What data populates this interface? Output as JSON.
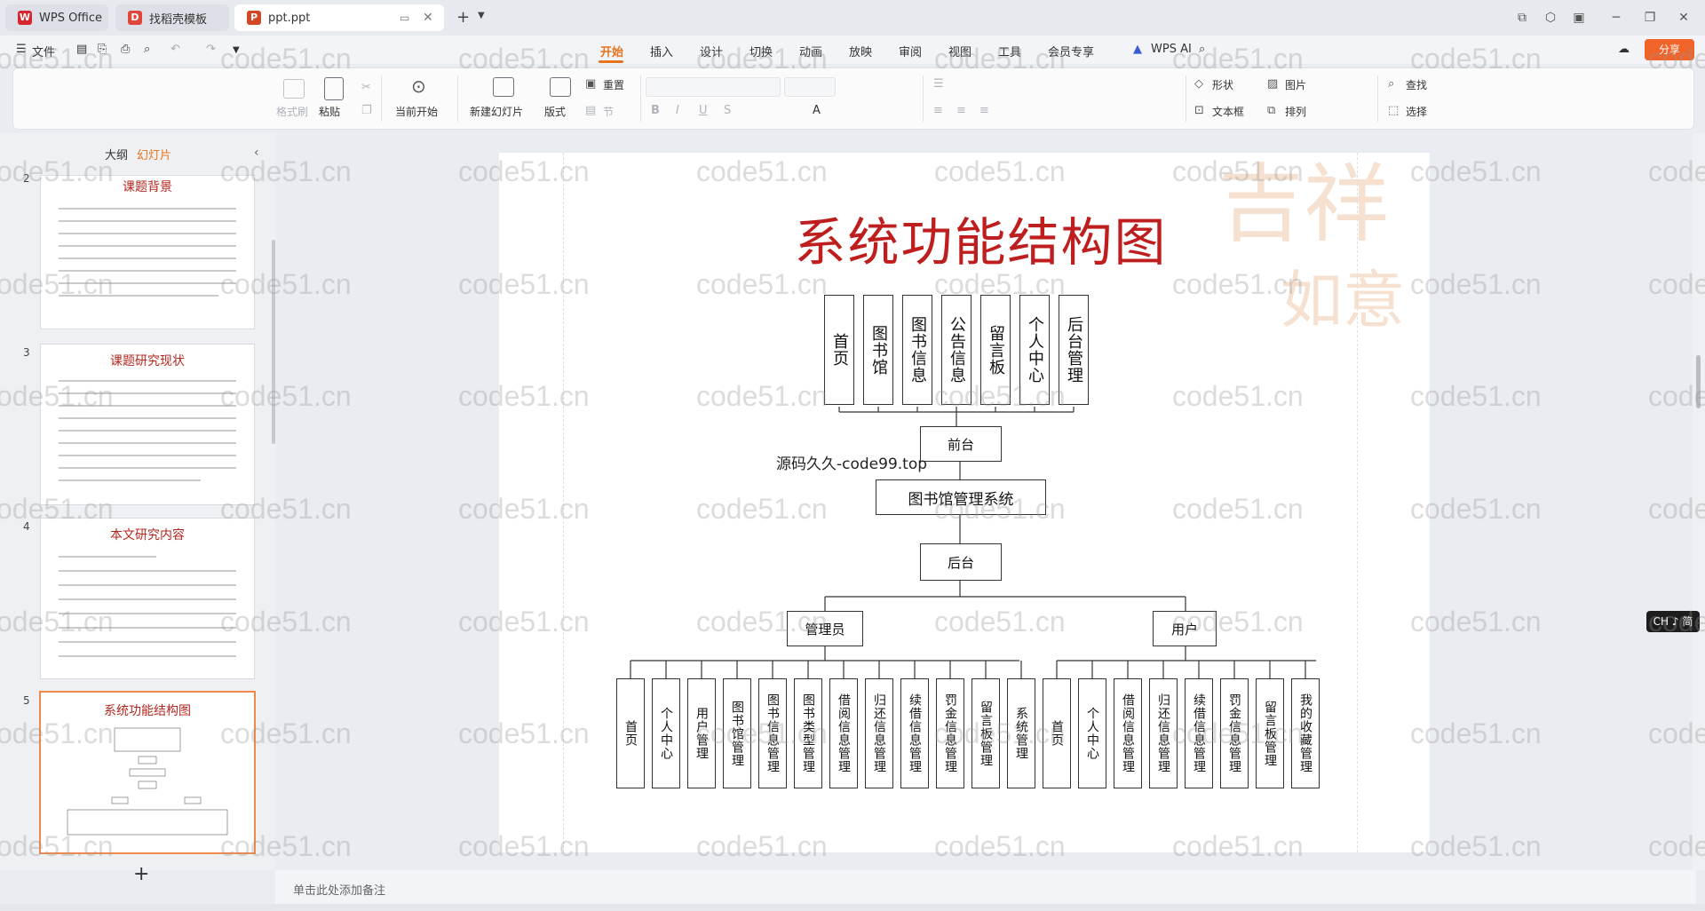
{
  "tabs": [
    {
      "label": "WPS Office",
      "icon": "wps-logo-icon"
    },
    {
      "label": "找稻壳模板",
      "icon": "docer-icon"
    },
    {
      "label": "ppt.ppt",
      "icon": "ppt-file-icon"
    }
  ],
  "menu": {
    "file": "文件",
    "items": [
      "开始",
      "插入",
      "设计",
      "切换",
      "动画",
      "放映",
      "审阅",
      "视图",
      "工具",
      "会员专享"
    ],
    "ai": "WPS AI",
    "share": "分享"
  },
  "ribbon": {
    "format_painter": "格式刷",
    "paste": "粘贴",
    "slideshow_from_current": "当前开始",
    "new_slide": "新建幻灯片",
    "layout": "版式",
    "reset": "重置",
    "section": "节",
    "shape": "形状",
    "picture": "图片",
    "textbox": "文本框",
    "arrange": "排列",
    "find": "查找",
    "select": "选择"
  },
  "panel": {
    "tab_outline": "大纲",
    "tab_slides": "幻灯片",
    "thumbs": [
      {
        "num": "2",
        "title": "课题背景"
      },
      {
        "num": "3",
        "title": "课题研究现状"
      },
      {
        "num": "4",
        "title": "本文研究内容"
      },
      {
        "num": "5",
        "title": "系统功能结构图"
      }
    ],
    "add": "+"
  },
  "slide": {
    "title": "系统功能结构图",
    "front_items": [
      "首页",
      "图书馆",
      "图书信息",
      "公告信息",
      "留言板",
      "个人中心",
      "后台管理"
    ],
    "front": "前台",
    "caption": "源码久久-code99.top",
    "system": "图书馆管理系统",
    "back": "后台",
    "admin": "管理员",
    "user": "用户",
    "admin_items": [
      "首页",
      "个人中心",
      "用户管理",
      "图书馆管理",
      "图书信息管理",
      "图书类型管理",
      "借阅信息管理",
      "归还信息管理",
      "续借信息管理",
      "罚金信息管理",
      "留言板管理",
      "系统管理"
    ],
    "user_items": [
      "首页",
      "个人中心",
      "借阅信息管理",
      "归还信息管理",
      "续借信息管理",
      "罚金信息管理",
      "留言板管理",
      "我的收藏管理"
    ]
  },
  "notes_placeholder": "单击此处添加备注",
  "ime": "CH ♪ 简",
  "watermark": "code51.cn",
  "colors": {
    "accent": "#e8731c",
    "title_red": "#bf1e1e",
    "share_bg": "#f0642a"
  }
}
